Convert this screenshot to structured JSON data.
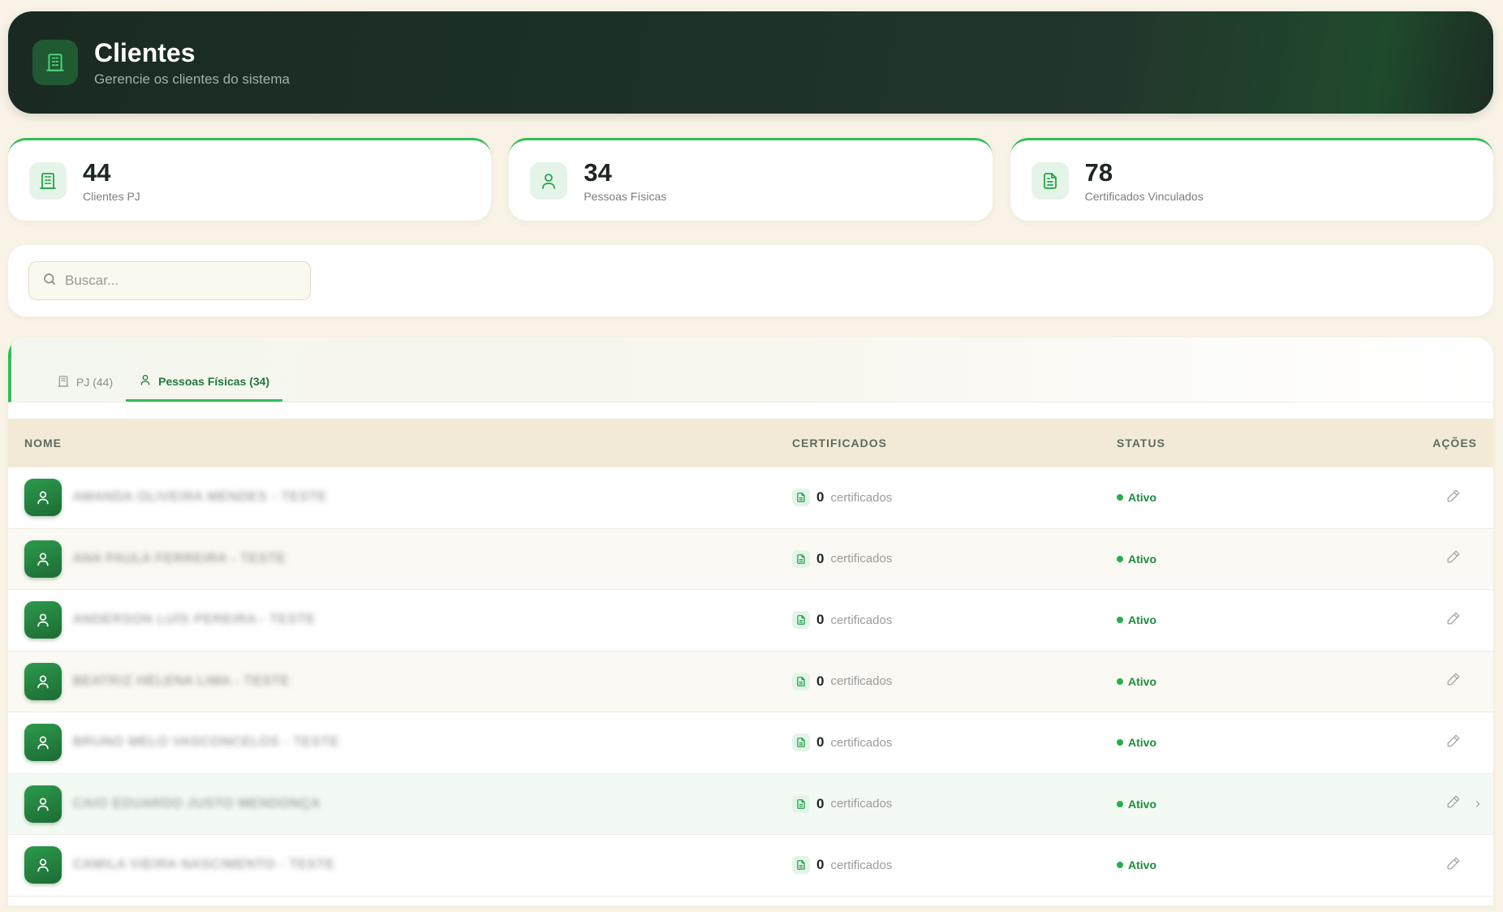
{
  "header": {
    "title": "Clientes",
    "subtitle": "Gerencie os clientes do sistema",
    "icon": "building-icon"
  },
  "stats": [
    {
      "value": "44",
      "label": "Clientes PJ",
      "icon": "building-icon"
    },
    {
      "value": "34",
      "label": "Pessoas Físicas",
      "icon": "user-icon"
    },
    {
      "value": "78",
      "label": "Certificados Vinculados",
      "icon": "document-icon"
    }
  ],
  "search": {
    "placeholder": "Buscar...",
    "value": ""
  },
  "tabs": [
    {
      "label": "PJ (44)",
      "active": false,
      "icon": "building-icon"
    },
    {
      "label": "Pessoas Físicas (34)",
      "active": true,
      "icon": "user-icon"
    }
  ],
  "table": {
    "headers": {
      "name": "NOME",
      "certs": "CERTIFICADOS",
      "status": "STATUS",
      "actions": "AÇÕES"
    },
    "rows": [
      {
        "name": "AMANDA OLIVEIRA MENDES - TESTE",
        "cert_count": "0",
        "cert_label": "certificados",
        "status": "Ativo"
      },
      {
        "name": "ANA PAULA FERREIRA - TESTE",
        "cert_count": "0",
        "cert_label": "certificados",
        "status": "Ativo"
      },
      {
        "name": "ANDERSON LUÍS PEREIRA - TESTE",
        "cert_count": "0",
        "cert_label": "certificados",
        "status": "Ativo"
      },
      {
        "name": "BEATRIZ HELENA LIMA - TESTE",
        "cert_count": "0",
        "cert_label": "certificados",
        "status": "Ativo"
      },
      {
        "name": "BRUNO MELO VASCONCELOS - TESTE",
        "cert_count": "0",
        "cert_label": "certificados",
        "status": "Ativo"
      },
      {
        "name": "CAIO EDUARDO JUSTO MENDONÇA",
        "cert_count": "0",
        "cert_label": "certificados",
        "status": "Ativo"
      },
      {
        "name": "CAMILA VIEIRA NASCIMENTO - TESTE",
        "cert_count": "0",
        "cert_label": "certificados",
        "status": "Ativo"
      }
    ]
  },
  "colors": {
    "accent": "#2fbf57",
    "header_bg": "#1d3127",
    "page_bg": "#f8f3e6"
  }
}
